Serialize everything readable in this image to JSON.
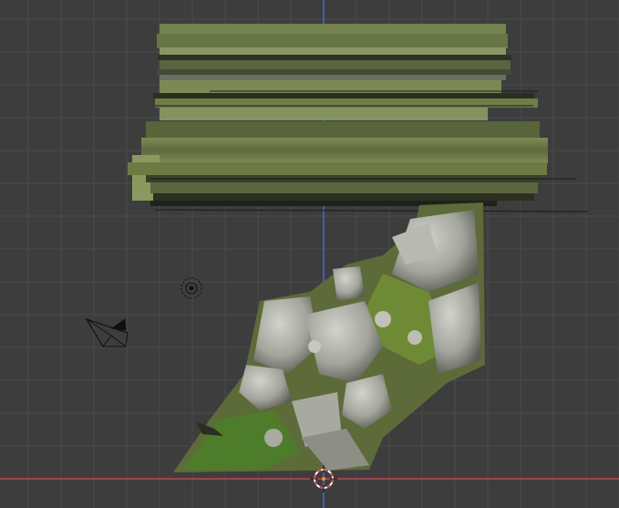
{
  "viewport": {
    "background": "#3d3d3d",
    "grid_color": "#4a4a4a",
    "x_axis_color": "#c8414b",
    "y_axis_color": "#3a6fd4"
  },
  "objects": {
    "mesh": {
      "kind": "photogrammetry-rock-mesh",
      "colors": [
        "#6f7a4e",
        "#8e9c62",
        "#4a5431",
        "#b7b9b0",
        "#5f8a2f"
      ]
    },
    "camera": {
      "kind": "camera"
    },
    "light": {
      "kind": "point-light"
    },
    "cursor": {
      "kind": "3d-cursor",
      "colors": [
        "#d94040",
        "#ffffff"
      ]
    }
  }
}
